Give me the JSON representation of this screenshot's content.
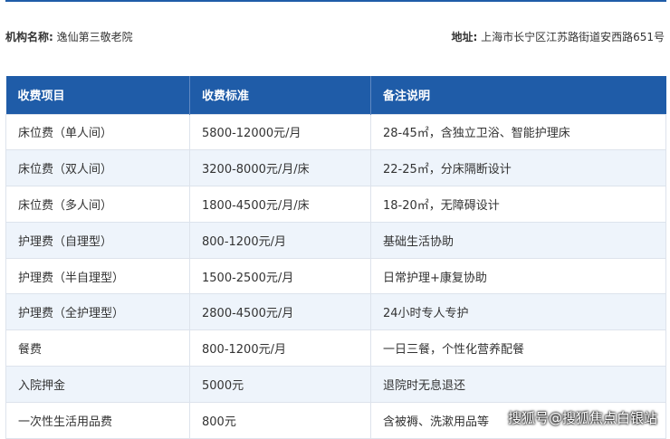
{
  "institution": {
    "name_label": "机构名称:",
    "name_value": "逸仙第三敬老院",
    "address_label": "地址:",
    "address_value": "上海市长宁区江苏路街道安西路651号"
  },
  "table": {
    "headers": [
      "收费项目",
      "收费标准",
      "备注说明"
    ],
    "rows": [
      [
        "床位费（单人间）",
        "5800-12000元/月",
        "28-45㎡，含独立卫浴、智能护理床"
      ],
      [
        "床位费（双人间）",
        "3200-8000元/月/床",
        "22-25㎡，分床隔断设计"
      ],
      [
        "床位费（多人间）",
        "1800-4500元/月/床",
        "18-20㎡，无障碍设计"
      ],
      [
        "护理费（自理型）",
        "800-1200元/月",
        "基础生活协助"
      ],
      [
        "护理费（半自理型）",
        "1500-2500元/月",
        "日常护理+康复协助"
      ],
      [
        "护理费（全护理型）",
        "2800-4500元/月",
        "24小时专人专护"
      ],
      [
        "餐费",
        "800-1200元/月",
        "一日三餐，个性化营养配餐"
      ],
      [
        "入院押金",
        "5000元",
        "退院时无息退还"
      ],
      [
        "一次性生活用品费",
        "800元",
        "含被褥、洗漱用品等"
      ]
    ]
  },
  "watermark": "搜狐号@搜狐焦点白银站",
  "colors": {
    "header_bg": "#1f5ca8",
    "stripe_bg": "#eef4fb"
  }
}
